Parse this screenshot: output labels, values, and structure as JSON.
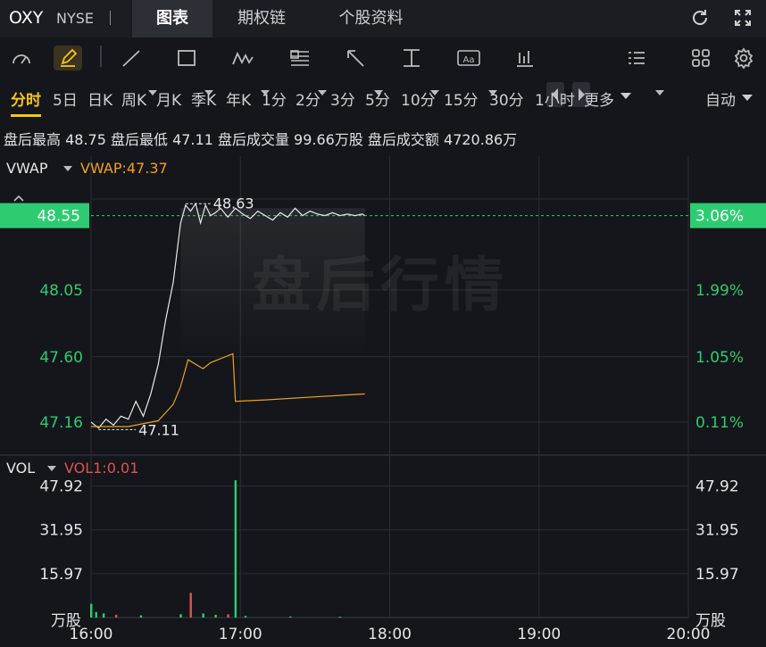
{
  "header": {
    "symbol": "OXY",
    "exchange": "NYSE",
    "separator": "|",
    "tabs": [
      {
        "label": "图表",
        "active": true
      },
      {
        "label": "期权链",
        "active": false
      },
      {
        "label": "个股资料",
        "active": false
      }
    ],
    "icons": [
      "refresh-icon",
      "fullscreen-icon"
    ]
  },
  "toolbar": {
    "tools": [
      "indicator-icon",
      "draw-pen-icon",
      "line-tool-icon",
      "rectangle-tool-icon",
      "wave-tool-icon",
      "fib-tool-icon",
      "arrow-tool-icon",
      "measure-tool-icon",
      "text-tool-icon",
      "candle-type-icon",
      "prev-icon",
      "next-icon",
      "layout-list-icon",
      "grid-layout-icon",
      "settings-icon"
    ]
  },
  "periods": {
    "items": [
      "分时",
      "5日",
      "日K",
      "周K",
      "月K",
      "季K",
      "年K",
      "1分",
      "2分",
      "3分",
      "5分",
      "10分",
      "15分",
      "30分",
      "1小时",
      "更多"
    ],
    "active": "分时",
    "scale_mode": "自动"
  },
  "stats": {
    "text": "盘后最高 48.75 盘后最低 47.11 盘后成交量 99.66万股 盘后成交额 4720.86万"
  },
  "price_panel": {
    "indicator": "VWAP",
    "indicator_value": "VWAP:47.37",
    "current_price": "48.55",
    "current_pct": "3.06%",
    "left_ticks": [
      "48.05",
      "47.60",
      "47.16"
    ],
    "right_ticks": [
      "1.99%",
      "1.05%",
      "0.11%"
    ],
    "high_label": "48.63",
    "low_label": "47.11",
    "watermark": "盘后行情"
  },
  "volume_panel": {
    "indicator": "VOL",
    "indicator_value": "VOL1:0.01",
    "ticks": [
      "47.92",
      "31.95",
      "15.97"
    ],
    "unit": "万股"
  },
  "x_axis": {
    "labels": [
      "16:00",
      "17:00",
      "18:00",
      "19:00",
      "20:00"
    ]
  },
  "colors": {
    "up": "#2ecc71",
    "down": "#e05252",
    "vwap": "#f0a020",
    "price_line": "#e8e8e8",
    "accent": "#f5c518"
  },
  "chart_data": {
    "type": "line",
    "x_unit": "time (ET, after-hours)",
    "x_range": [
      "16:00",
      "20:00"
    ],
    "price_range": [
      46.95,
      48.95
    ],
    "series": [
      {
        "name": "price",
        "x": [
          "16:00",
          "16:03",
          "16:06",
          "16:09",
          "16:12",
          "16:15",
          "16:18",
          "16:21",
          "16:24",
          "16:27",
          "16:30",
          "16:33",
          "16:36",
          "16:38",
          "16:40",
          "16:42",
          "16:44",
          "16:46",
          "16:48",
          "16:50",
          "16:52",
          "16:55",
          "16:58",
          "17:01",
          "17:04",
          "17:07",
          "17:10",
          "17:13",
          "17:16",
          "17:19",
          "17:22",
          "17:25",
          "17:28",
          "17:31",
          "17:34",
          "17:37",
          "17:40",
          "17:43",
          "17:46",
          "17:49",
          "17:50"
        ],
        "values": [
          47.16,
          47.12,
          47.18,
          47.14,
          47.2,
          47.18,
          47.3,
          47.2,
          47.35,
          47.55,
          47.85,
          48.1,
          48.5,
          48.62,
          48.58,
          48.63,
          48.5,
          48.62,
          48.55,
          48.57,
          48.6,
          48.54,
          48.6,
          48.56,
          48.53,
          48.58,
          48.55,
          48.52,
          48.57,
          48.54,
          48.6,
          48.55,
          48.58,
          48.56,
          48.55,
          48.57,
          48.55,
          48.56,
          48.55,
          48.56,
          48.55
        ]
      },
      {
        "name": "VWAP",
        "x": [
          "16:00",
          "16:15",
          "16:27",
          "16:33",
          "16:36",
          "16:39",
          "16:45",
          "16:48",
          "16:57",
          "16:58",
          "17:10",
          "17:30",
          "17:50"
        ],
        "values": [
          47.13,
          47.13,
          47.17,
          47.28,
          47.4,
          47.58,
          47.52,
          47.56,
          47.62,
          47.3,
          47.31,
          47.33,
          47.35
        ]
      }
    ],
    "volume": {
      "ticks": [
        15.97,
        31.95,
        47.92
      ],
      "unit": "万股",
      "x": [
        "16:00",
        "16:02",
        "16:05",
        "16:10",
        "16:20",
        "16:36",
        "16:40",
        "16:45",
        "16:50",
        "16:55",
        "16:58",
        "17:02",
        "17:20",
        "17:40"
      ],
      "values": [
        5,
        2,
        1.5,
        1,
        0.8,
        1.2,
        9,
        1.5,
        1,
        1.2,
        50,
        0.6,
        0.4,
        0.3
      ],
      "direction": [
        "up",
        "up",
        "up",
        "down",
        "up",
        "up",
        "down",
        "up",
        "up",
        "down",
        "up",
        "up",
        "up",
        "up"
      ]
    }
  }
}
